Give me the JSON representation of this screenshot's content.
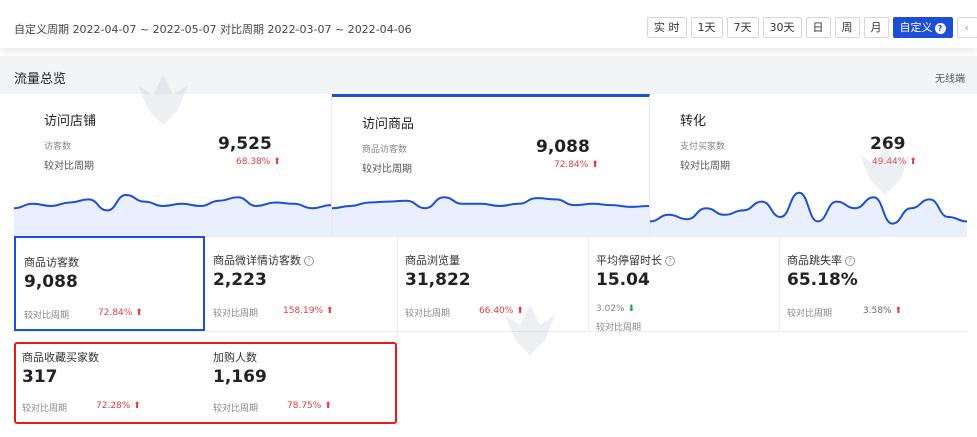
{
  "toolbar": {
    "period_text": "自定义周期 2022-04-07 ~ 2022-05-07 对比周期 2022-03-07 ~ 2022-04-06",
    "buttons": [
      "实 时",
      "1天",
      "7天",
      "30天",
      "日",
      "周",
      "月"
    ],
    "custom_label": "自定义",
    "prev": "‹",
    "next": "›"
  },
  "section": {
    "title": "流量总览",
    "device": "无线端"
  },
  "top_cards": [
    {
      "title": "访问店铺",
      "metric": "访客数",
      "compare": "较对比周期",
      "value": "9,525",
      "pct": "68.38%",
      "trend": [
        0.55,
        0.45,
        0.5,
        0.42,
        0.35,
        0.6,
        0.25,
        0.4,
        0.5,
        0.45,
        0.5,
        0.38,
        0.3,
        0.5,
        0.42,
        0.45,
        0.55,
        0.48
      ]
    },
    {
      "title": "访问商品",
      "metric": "商品访客数",
      "compare": "较对比周期",
      "value": "9,088",
      "pct": "72.84%",
      "trend": [
        0.55,
        0.5,
        0.42,
        0.4,
        0.38,
        0.55,
        0.3,
        0.45,
        0.45,
        0.5,
        0.45,
        0.32,
        0.35,
        0.48,
        0.45,
        0.48,
        0.52,
        0.5
      ]
    },
    {
      "title": "转化",
      "metric": "支付买家数",
      "compare": "较对比周期",
      "value": "269",
      "pct": "49.44%",
      "trend": [
        0.85,
        0.7,
        0.8,
        0.55,
        0.7,
        0.6,
        0.4,
        0.75,
        0.2,
        0.85,
        0.4,
        0.55,
        0.3,
        0.9,
        0.55,
        0.35,
        0.75,
        0.85
      ]
    }
  ],
  "metrics": [
    {
      "title": "商品访客数",
      "value": "9,088",
      "compare": "较对比周期",
      "pct": "72.84%",
      "dir": "up",
      "info": false
    },
    {
      "title": "商品微详情访客数",
      "value": "2,223",
      "compare": "较对比周期",
      "pct": "158.19%",
      "dir": "up",
      "info": true
    },
    {
      "title": "商品浏览量",
      "value": "31,822",
      "compare": "较对比周期",
      "pct": "66.40%",
      "dir": "up",
      "info": false
    },
    {
      "title": "平均停留时长",
      "value": "15.04",
      "compare": "较对比周期",
      "pct": "3.02%",
      "dir": "down",
      "info": true
    },
    {
      "title": "商品跳失率",
      "value": "65.18%",
      "compare": "较对比周期",
      "pct": "3.58%",
      "dir": "up",
      "info": true
    },
    {
      "title": "商品收藏买家数",
      "value": "317",
      "compare": "较对比周期",
      "pct": "72.28%",
      "dir": "up",
      "info": false
    },
    {
      "title": "加购人数",
      "value": "1,169",
      "compare": "较对比周期",
      "pct": "78.75%",
      "dir": "up",
      "info": false
    }
  ],
  "watermark": "火蝠电商",
  "colors": {
    "accent": "#1c4fd6",
    "up": "#e23c3c",
    "down": "#18a058",
    "highlight": "#e11d1d"
  }
}
